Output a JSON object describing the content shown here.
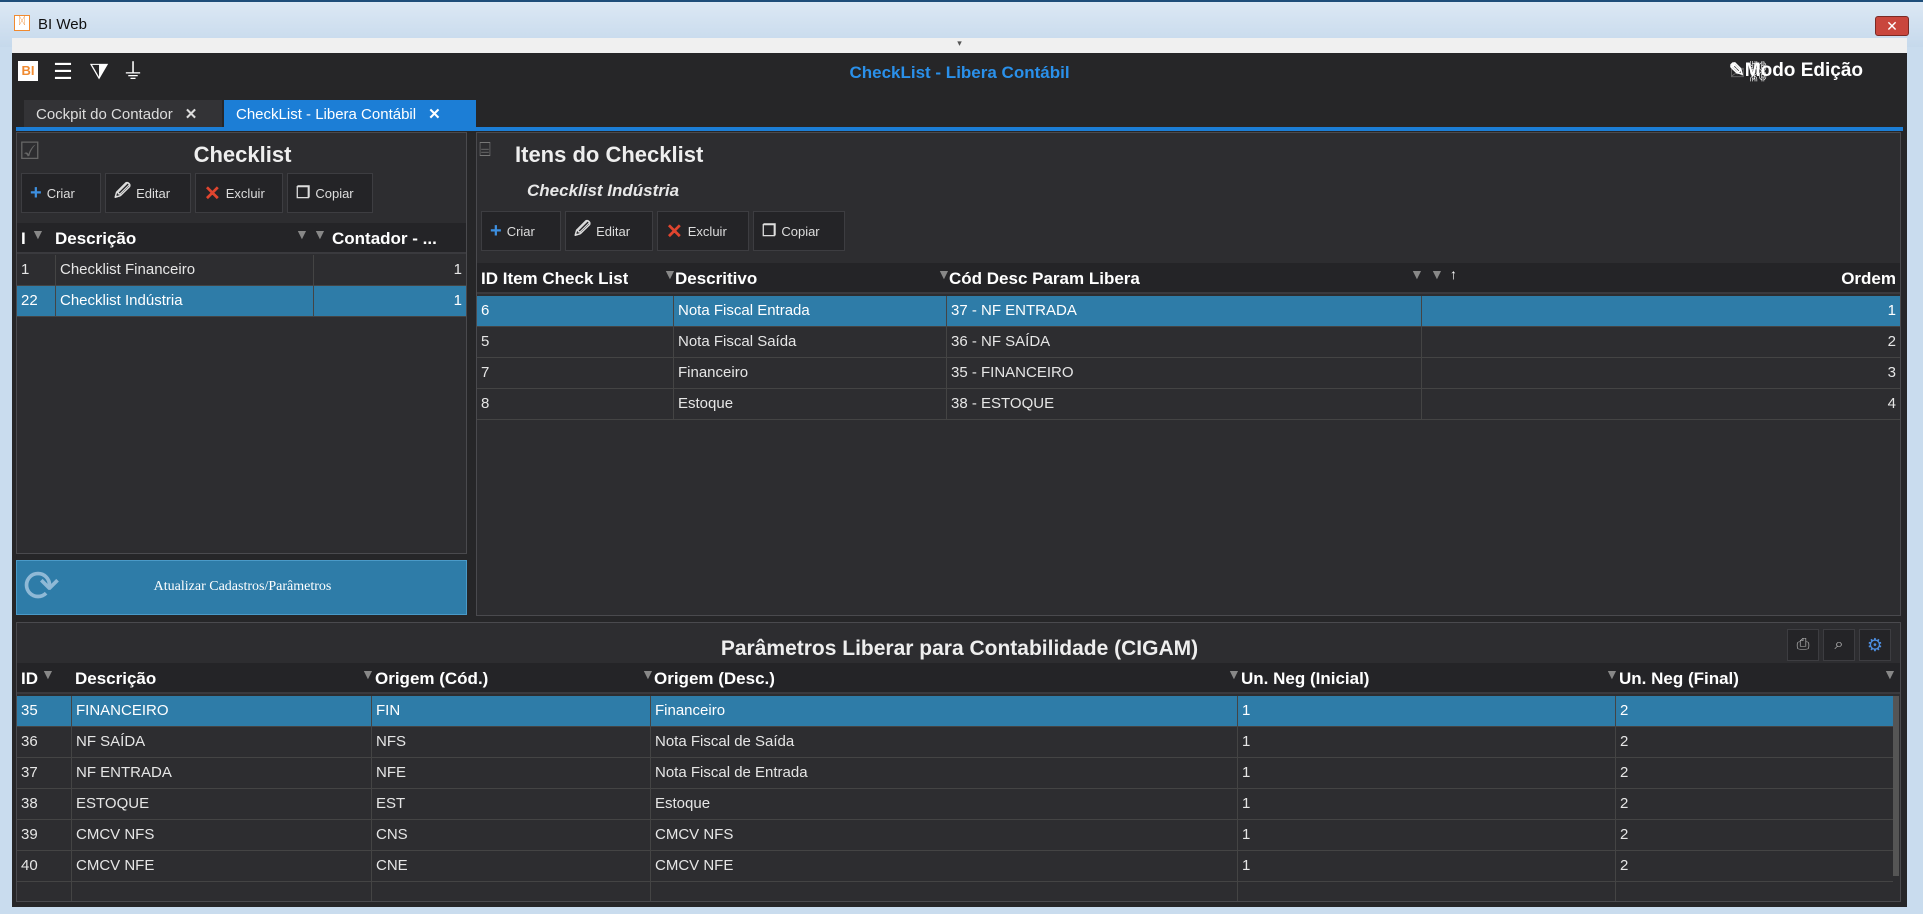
{
  "window": {
    "title": "BI Web",
    "close": "✕"
  },
  "toolbar": {
    "app_title": "CheckList - Libera Contábil",
    "mode_label": "Modo Edição"
  },
  "tabs": [
    {
      "label": "Cockpit do Contador",
      "active": false
    },
    {
      "label": "CheckList - Libera Contábil",
      "active": true
    }
  ],
  "checklist": {
    "title": "Checklist",
    "buttons": {
      "create": "Criar",
      "edit": "Editar",
      "delete": "Excluir",
      "copy": "Copiar"
    },
    "columns": [
      "I",
      "Descrição",
      "Contador - ..."
    ],
    "rows": [
      [
        "1",
        "Checklist Financeiro",
        "1"
      ],
      [
        "22",
        "Checklist Indústria",
        "1"
      ]
    ],
    "selected_row": 1,
    "update_button": "Atualizar Cadastros/Parâmetros"
  },
  "items": {
    "title": "Itens do Checklist",
    "subtitle": "Checklist Indústria",
    "buttons": {
      "create": "Criar",
      "edit": "Editar",
      "delete": "Excluir",
      "copy": "Copiar"
    },
    "columns": [
      "ID Item Check List",
      "Descritivo",
      "Cód Desc Param Libera",
      "Ordem"
    ],
    "rows": [
      [
        "6",
        "Nota Fiscal Entrada",
        "37 - NF ENTRADA",
        "1"
      ],
      [
        "5",
        "Nota Fiscal Saída",
        "36 - NF SAÍDA",
        "2"
      ],
      [
        "7",
        "Financeiro",
        "35 - FINANCEIRO",
        "3"
      ],
      [
        "8",
        "Estoque",
        "38 - ESTOQUE",
        "4"
      ]
    ],
    "selected_row": 0
  },
  "params": {
    "title": "Parâmetros Liberar para Contabilidade (CIGAM)",
    "columns": [
      "ID",
      "Descrição",
      "Origem (Cód.)",
      "Origem (Desc.)",
      "Un. Neg (Inicial)",
      "Un. Neg (Final)"
    ],
    "rows": [
      [
        "35",
        "FINANCEIRO",
        "FIN",
        "Financeiro",
        "1",
        "2"
      ],
      [
        "36",
        "NF SAÍDA",
        "NFS",
        "Nota Fiscal de Saída",
        "1",
        "2"
      ],
      [
        "37",
        "NF ENTRADA",
        "NFE",
        "Nota Fiscal de Entrada",
        "1",
        "2"
      ],
      [
        "38",
        "ESTOQUE",
        "EST",
        "Estoque",
        "1",
        "2"
      ],
      [
        "39",
        "CMCV NFS",
        "CNS",
        "CMCV NFS",
        "1",
        "2"
      ],
      [
        "40",
        "CMCV NFE",
        "CNE",
        "CMCV NFE",
        "1",
        "2"
      ]
    ],
    "selected_row": 0
  },
  "colors": {
    "accent": "#1c7ed6",
    "selected": "#2e7ca8",
    "title": "#2a90ea",
    "delete": "#e0452f",
    "create": "#3d8fe0"
  }
}
